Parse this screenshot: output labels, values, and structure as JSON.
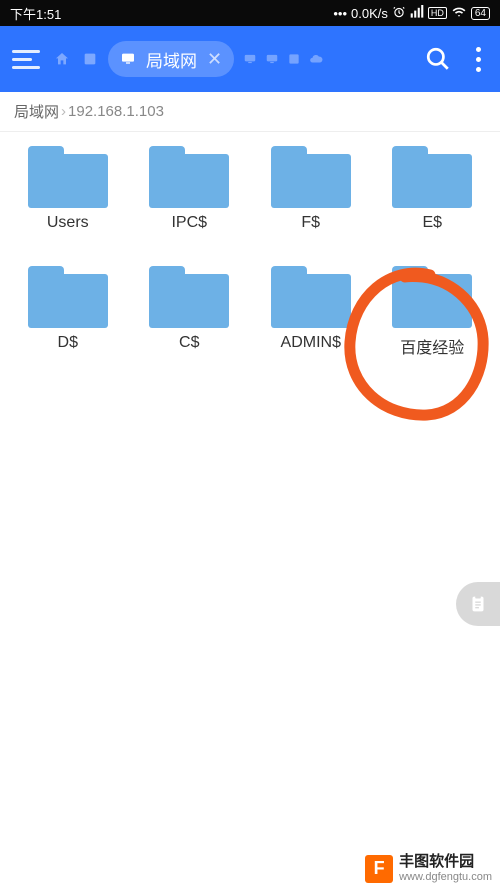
{
  "status": {
    "time": "下午1:51",
    "net_speed": "0.0K/s",
    "battery": "64"
  },
  "appbar": {
    "active_tab_label": "局域网"
  },
  "breadcrumb": {
    "root": "局域网",
    "sep": "›",
    "path": "192.168.1.103"
  },
  "folders": [
    {
      "label": "Users"
    },
    {
      "label": "IPC$"
    },
    {
      "label": "F$"
    },
    {
      "label": "E$"
    },
    {
      "label": "D$"
    },
    {
      "label": "C$"
    },
    {
      "label": "ADMIN$"
    },
    {
      "label": "百度经验"
    }
  ],
  "watermark": {
    "logo_letter": "F",
    "title": "丰图软件园",
    "url": "www.dgfengtu.com"
  },
  "colors": {
    "primary": "#2e74ff",
    "folder": "#6db1e6",
    "annotation": "#f05a1f"
  }
}
